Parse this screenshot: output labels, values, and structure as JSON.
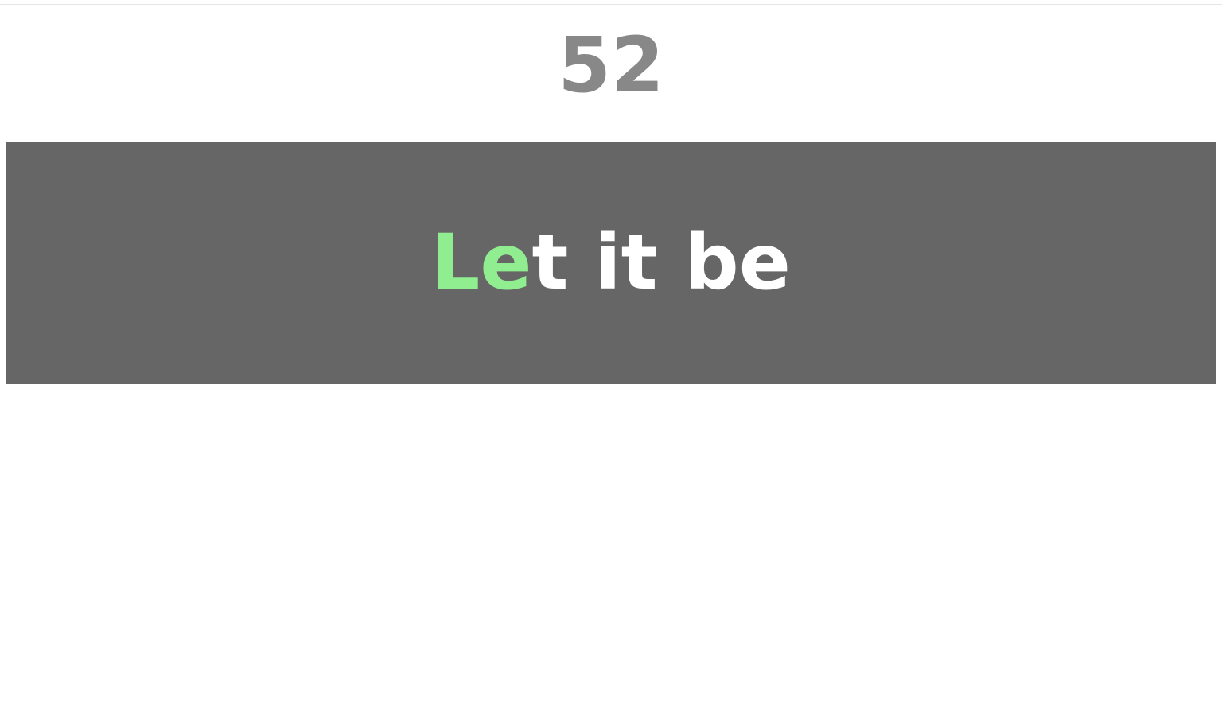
{
  "counter": {
    "value": "52"
  },
  "phrase": {
    "typed": "Le",
    "remaining": "t it be"
  },
  "colors": {
    "counter_text": "#888888",
    "panel_background": "#666666",
    "typed_text": "#90ee90",
    "remaining_text": "#ffffff"
  }
}
